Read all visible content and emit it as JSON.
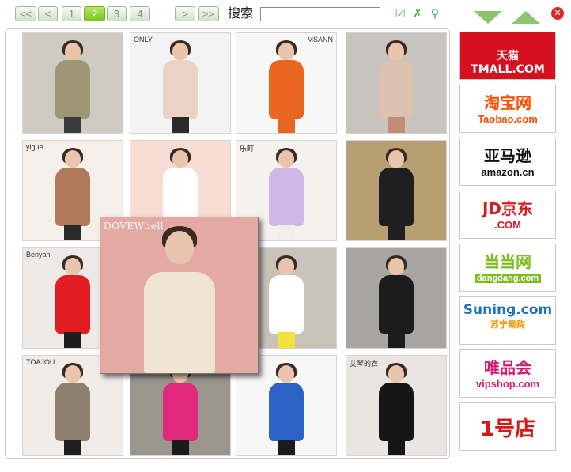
{
  "toolbar": {
    "nav_first": "<<",
    "nav_prev": "<",
    "pages": [
      "1",
      "2",
      "3",
      "4"
    ],
    "active_page": "2",
    "nav_next": ">",
    "nav_last": ">>",
    "search_label": "搜索",
    "search_value": "",
    "confirm_symbol": "☑",
    "clear_symbol": "✗",
    "find_symbol": "⚲",
    "close_symbol": "✕"
  },
  "products": [
    {
      "brand": "",
      "bg": "#cfcac2",
      "coat": "#9f9676",
      "legs": "#3b3b3b"
    },
    {
      "brand": "ONLY",
      "bg": "#f3f3f3",
      "coat": "#ead3c5",
      "legs": "#2a2a2a"
    },
    {
      "brand": "MSANN",
      "bg": "#f7f7f7",
      "coat": "#e8661f",
      "legs": "#e8661f"
    },
    {
      "brand": "",
      "bg": "#c7c4bd",
      "coat": "#dcc1b1",
      "legs": "#c48a7a"
    },
    {
      "brand": "yigue",
      "bg": "#f4efe8",
      "coat": "#b07a5a",
      "legs": "#2a2a2a"
    },
    {
      "brand": "",
      "bg": "#f6dcd3",
      "coat": "#ffffff",
      "legs": "#e5527a"
    },
    {
      "brand": "乐町",
      "bg": "#f5f2ee",
      "coat": "#cdb8e6",
      "legs": "#f3efe8"
    },
    {
      "brand": "",
      "bg": "#b89f72",
      "coat": "#1f1f1f",
      "legs": "#1f1f1f"
    },
    {
      "brand": "Benyani",
      "bg": "#ece9e6",
      "coat": "#e01e22",
      "legs": "#1d1d1d"
    },
    {
      "brand": "",
      "bg": "#ffffff",
      "coat": "#ffffff",
      "legs": "#ffffff"
    },
    {
      "brand": "",
      "bg": "#c9c2b8",
      "coat": "#ffffff",
      "legs": "#f1e33c"
    },
    {
      "brand": "",
      "bg": "#a8a6a2",
      "coat": "#1c1c1c",
      "legs": "#1c1c1c"
    },
    {
      "brand": "TOAJOU",
      "bg": "#f1ece7",
      "coat": "#8e826f",
      "legs": "#1e1e1e"
    },
    {
      "brand": "",
      "bg": "#9a968e",
      "coat": "#e0297d",
      "legs": "#1a1a1a"
    },
    {
      "brand": "",
      "bg": "#f7f7f7",
      "coat": "#2c62c6",
      "legs": "#1b1b1b"
    },
    {
      "brand": "艾琴的衣",
      "bg": "#e9e6e2",
      "coat": "#161616",
      "legs": "#161616"
    }
  ],
  "preview": {
    "brand": "DOVEWhell",
    "bg": "#e4a9a3",
    "coat": "#efe6d2",
    "legs": "#1a1a1a"
  },
  "stores": [
    {
      "name": "天猫TMALL.COM",
      "line1": "天猫TMALL.COM",
      "line2": "",
      "bg": "#d6101f",
      "color": "#ffffff",
      "color2": "#ffffff"
    },
    {
      "name": "淘宝网 Taobao.com",
      "line1": "淘宝网",
      "line2": "Taobao.com",
      "bg": "#ffffff",
      "color": "#ff4d00",
      "color2": "#ff4d00"
    },
    {
      "name": "亚马逊 amazon.cn",
      "line1": "亚马逊",
      "line2": "amazon.cn",
      "bg": "#ffffff",
      "color": "#111111",
      "color2": "#111111"
    },
    {
      "name": "JD.COM 京东",
      "line1": "JD京东",
      "line2": ".COM",
      "bg": "#ffffff",
      "color": "#d71c24",
      "color2": "#d71c24"
    },
    {
      "name": "当当网 dangdang.com",
      "line1": "当当网",
      "line2": "dangdang.com",
      "bg": "#ffffff",
      "color": "#7dbb1f",
      "color2": "#ffffff"
    },
    {
      "name": "Suning.com 苏宁易购",
      "line1": "Suning.com",
      "line2": "苏宁易购",
      "bg": "#ffffff",
      "color": "#1b75bb",
      "color2": "#f39800"
    },
    {
      "name": "唯品会 vipshop.com",
      "line1": "唯品会",
      "line2": "vipshop.com",
      "bg": "#ffffff",
      "color": "#d61a75",
      "color2": "#d61a75"
    },
    {
      "name": "1号店",
      "line1": "1号店",
      "line2": "",
      "bg": "#ffffff",
      "color": "#d21a1a",
      "color2": "#d21a1a"
    }
  ]
}
